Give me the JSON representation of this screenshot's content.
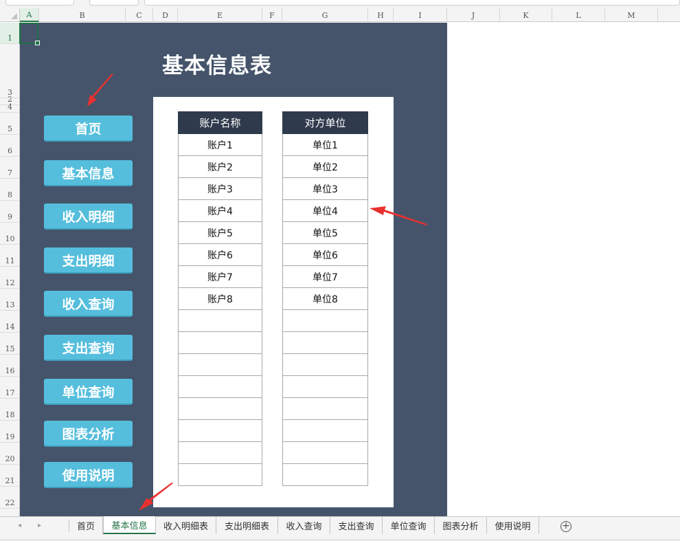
{
  "columns": [
    "A",
    "B",
    "C",
    "D",
    "E",
    "F",
    "G",
    "H",
    "I",
    "J",
    "K",
    "L",
    "M"
  ],
  "rows": [
    "1",
    "2",
    "3",
    "4",
    "5",
    "6",
    "7",
    "8",
    "9",
    "10",
    "11",
    "12",
    "13",
    "14",
    "15",
    "16",
    "17",
    "18",
    "19",
    "20",
    "21",
    "22"
  ],
  "panel": {
    "title": "基本信息表",
    "bg_color": "#45546b",
    "button_color": "#55bedc"
  },
  "nav_buttons": [
    "首页",
    "基本信息",
    "收入明细",
    "支出明细",
    "收入查询",
    "支出查询",
    "单位查询",
    "图表分析",
    "使用说明"
  ],
  "accounts_table": {
    "header": "账户名称",
    "cells": [
      "账户1",
      "账户2",
      "账户3",
      "账户4",
      "账户5",
      "账户6",
      "账户7",
      "账户8",
      "",
      "",
      "",
      "",
      "",
      "",
      "",
      ""
    ]
  },
  "units_table": {
    "header": "对方单位",
    "cells": [
      "单位1",
      "单位2",
      "单位3",
      "单位4",
      "单位5",
      "单位6",
      "单位7",
      "单位8",
      "",
      "",
      "",
      "",
      "",
      "",
      "",
      ""
    ]
  },
  "sheet_tabs": [
    "首页",
    "基本信息",
    "收入明细表",
    "支出明细表",
    "收入查询",
    "支出查询",
    "单位查询",
    "图表分析",
    "使用说明"
  ],
  "active_sheet": "基本信息",
  "scroll_prev": "◂",
  "scroll_next": "▸",
  "add_sheet": "+"
}
